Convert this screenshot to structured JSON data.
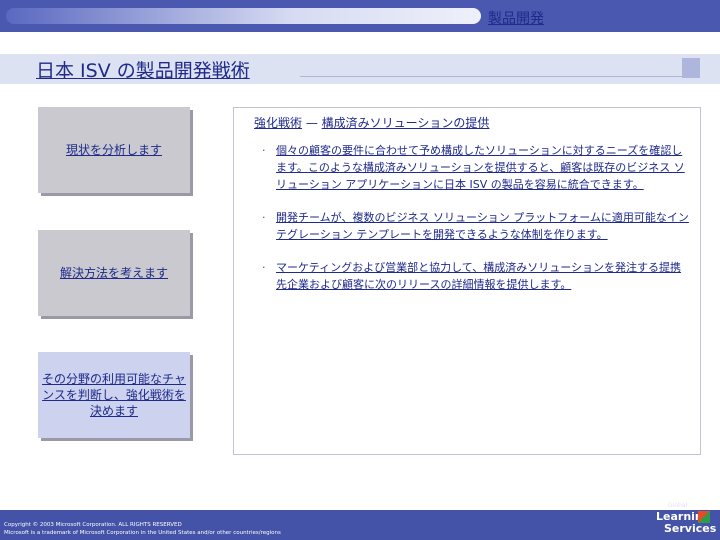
{
  "header": {
    "section_label": "製品開発"
  },
  "title": "日本 ISV の製品開発戦術",
  "left_boxes": [
    {
      "label": "現状を分析します"
    },
    {
      "label": "解決方法を考えます"
    },
    {
      "label": "その分野の利用可能なチャンスを判断し、強化戦術を決めます"
    }
  ],
  "panel": {
    "heading_part1": "強化戦術",
    "heading_dash": " — ",
    "heading_part2": "構成済みソリューションの提供",
    "bullet_glyph": "·",
    "bullets": [
      "個々の顧客の要件に合わせて予め構成したソリューションに対するニーズを確認します。このような構成済みソリューションを提供すると、顧客は既存のビジネス ソリューション アプリケーションに日本 ISV の製品を容易に統合できます。",
      "開発チームが、複数のビジネス ソリューション プラットフォームに適用可能なインテグレーション テンプレートを開発できるような体制を作ります。",
      "マーケティングおよび営業部と協力して、構成済みソリューションを発注する提携先企業および顧客に次のリリースの詳細情報を提供します。"
    ]
  },
  "footer": {
    "copyright": "Copyright © 2003 Microsoft Corporation. ALL RIGHTS RESERVED",
    "trademark": "Microsoft is a trademark of Microsoft Corporation in the United States and/or other countries/regions"
  },
  "logo": {
    "line_global": "Global",
    "line1": "Learning",
    "line2": "Services"
  },
  "colors": {
    "accent": "#1f2a8a",
    "frame": "#4452a8",
    "title_band": "#dde2f2",
    "box": "#c9c9cf"
  }
}
